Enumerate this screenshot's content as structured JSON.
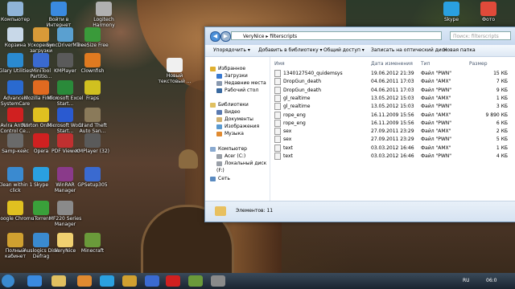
{
  "desktop": {
    "icons": [
      {
        "label": "Компьютер",
        "color": "#8fb4d8"
      },
      {
        "label": "Войти в Интернет",
        "color": "#3a8ae0"
      },
      {
        "label": "Logitech Harmony",
        "color": "#b0b0b0"
      },
      {
        "label": "Корзина",
        "color": "#c8d8e8"
      },
      {
        "label": "Ускорение загрузки",
        "color": "#d89a38"
      },
      {
        "label": "SyncDriverMine",
        "color": "#5aa0d0"
      },
      {
        "label": "TreeSize Free",
        "color": "#3a9a3a"
      },
      {
        "label": "Glary Utilities",
        "color": "#2a8ad0"
      },
      {
        "label": "MiniTool Partitio...",
        "color": "#3a6ad0"
      },
      {
        "label": "KMPlayer",
        "color": "#5a5a5a"
      },
      {
        "label": "Clownfish",
        "color": "#e07a20"
      },
      {
        "label": "Advanced SystemCare",
        "color": "#2a6ad0"
      },
      {
        "label": "Mozilla Firefox",
        "color": "#e06a20"
      },
      {
        "label": "Microsoft Excel Start...",
        "color": "#2a8a3a"
      },
      {
        "label": "Fraps",
        "color": "#d0c020"
      },
      {
        "label": "Avira AntiVir Control Ce...",
        "color": "#d02020"
      },
      {
        "label": "Norton Online...",
        "color": "#e0c020"
      },
      {
        "label": "Microsoft Word Start...",
        "color": "#2a5ad0"
      },
      {
        "label": "Grand Theft Auto San...",
        "color": "#8a7a5a"
      },
      {
        "label": "Samp-кейс",
        "color": "#6a6a6a"
      },
      {
        "label": "Opera",
        "color": "#d02020"
      },
      {
        "label": "PDF Viewer",
        "color": "#c03030"
      },
      {
        "label": "KMPlayer (32)",
        "color": "#5a5a5a"
      },
      {
        "label": "Clean within 1 click",
        "color": "#3a8ad0"
      },
      {
        "label": "Skype",
        "color": "#2aa0e0"
      },
      {
        "label": "WinRAR Manager",
        "color": "#8a3a8a"
      },
      {
        "label": "GPSetup305",
        "color": "#3a6ad0"
      },
      {
        "label": "Google Chrome",
        "color": "#e0c020"
      },
      {
        "label": "uTorrent",
        "color": "#3aa03a"
      },
      {
        "label": "MF220 Series Manager",
        "color": "#8a8a8a"
      },
      {
        "label": "Новый текстовый ...",
        "color": "#f0f0f0"
      },
      {
        "label": "Auslogics Disk Defrag",
        "color": "#3a8ad0"
      },
      {
        "label": "VeryNice",
        "color": "#f0d070"
      },
      {
        "label": "Minecraft",
        "color": "#6a9a3a"
      },
      {
        "label": "Полный кабинет",
        "color": "#d0a030"
      },
      {
        "label": "Skype",
        "color": "#2aa0e0"
      },
      {
        "label": "Фото",
        "color": "#e04a3a"
      }
    ]
  },
  "explorer": {
    "address": "VeryNice ▸ filterscripts",
    "search_placeholder": "Поиск: filterscripts",
    "toolbar": [
      "Упорядочить ▾",
      "Добавить в библиотеку ▾",
      "Общий доступ ▾",
      "Записать на оптический диск",
      "Новая папка"
    ],
    "sidebar": [
      {
        "label": "Избранное",
        "color": "#e0b030"
      },
      {
        "label": "Загрузки",
        "color": "#3a7ad0"
      },
      {
        "label": "Недавние места",
        "color": "#8a9ab0"
      },
      {
        "label": "Рабочий стол",
        "color": "#3a6aa0"
      },
      {
        "label": "Библиотеки",
        "color": "#e0c060"
      },
      {
        "label": "Видео",
        "color": "#5a7ab0"
      },
      {
        "label": "Документы",
        "color": "#d0b070"
      },
      {
        "label": "Изображения",
        "color": "#5a9ad0"
      },
      {
        "label": "Музыка",
        "color": "#e08a30"
      },
      {
        "label": "Компьютер",
        "color": "#8aaad0"
      },
      {
        "label": "Acer (C:)",
        "color": "#9aa0a8"
      },
      {
        "label": "Локальный диск (F:)",
        "color": "#9aa0a8"
      },
      {
        "label": "Сеть",
        "color": "#5a8ac0"
      }
    ],
    "columns": [
      "Имя",
      "Дата изменения",
      "Тип",
      "Размер"
    ],
    "files": [
      {
        "name": "1340127540_quidemsys",
        "date": "19.06.2012 21:39",
        "type": "Файл \"PWN\"",
        "size": "15 КБ"
      },
      {
        "name": "DropGun_death",
        "date": "04.06.2011 17:03",
        "type": "Файл \"AMX\"",
        "size": "7 КБ"
      },
      {
        "name": "DropGun_death",
        "date": "04.06.2011 17:03",
        "type": "Файл \"PWN\"",
        "size": "9 КБ"
      },
      {
        "name": "gl_realtime",
        "date": "13.05.2012 15:03",
        "type": "Файл \"AMX\"",
        "size": "1 КБ"
      },
      {
        "name": "gl_realtime",
        "date": "13.05.2012 15:03",
        "type": "Файл \"PWN\"",
        "size": "3 КБ"
      },
      {
        "name": "rope_eng",
        "date": "16.11.2009 15:56",
        "type": "Файл \"AMX\"",
        "size": "9 890 КБ"
      },
      {
        "name": "rope_eng",
        "date": "16.11.2009 15:56",
        "type": "Файл \"PWN\"",
        "size": "6 КБ"
      },
      {
        "name": "sex",
        "date": "27.09.2011 23:29",
        "type": "Файл \"AMX\"",
        "size": "2 КБ"
      },
      {
        "name": "sex",
        "date": "27.09.2011 23:29",
        "type": "Файл \"PWN\"",
        "size": "5 КБ"
      },
      {
        "name": "text",
        "date": "03.03.2012 16:46",
        "type": "Файл \"AMX\"",
        "size": "1 КБ"
      },
      {
        "name": "text",
        "date": "03.03.2012 16:46",
        "type": "Файл \"PWN\"",
        "size": "4 КБ"
      }
    ],
    "status": "Элементов: 11"
  },
  "taskbar": {
    "items": [
      {
        "name": "start",
        "color": "#3a8ad0"
      },
      {
        "name": "ie",
        "color": "#3a8ae0"
      },
      {
        "name": "explorer",
        "color": "#e0c060"
      },
      {
        "name": "media",
        "color": "#e08a30"
      },
      {
        "name": "skype",
        "color": "#2aa0e0"
      },
      {
        "name": "shield",
        "color": "#d0a030"
      },
      {
        "name": "network",
        "color": "#3a6ad0"
      },
      {
        "name": "opera",
        "color": "#d02020"
      },
      {
        "name": "game",
        "color": "#6a9a3a"
      },
      {
        "name": "tool",
        "color": "#8a8a8a"
      }
    ],
    "lang": "RU",
    "clock": "06:0"
  }
}
